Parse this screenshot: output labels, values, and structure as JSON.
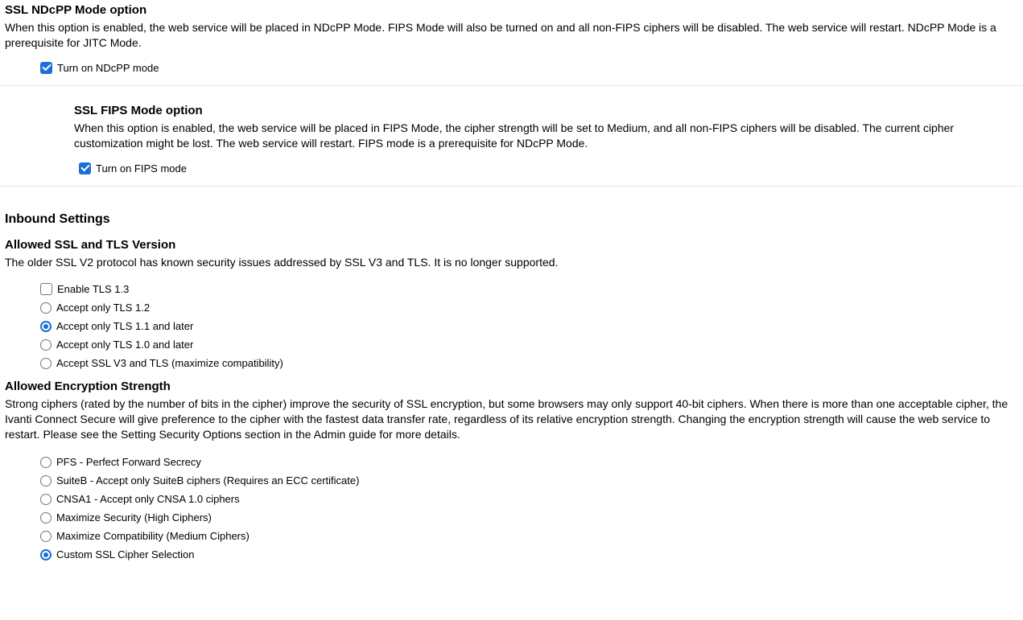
{
  "ndcpp": {
    "title": "SSL NDcPP Mode option",
    "description": "When this option is enabled, the web service will be placed in NDcPP Mode. FIPS Mode will also be turned on and all non-FIPS ciphers will be disabled. The web service will restart. NDcPP Mode is a prerequisite for JITC Mode.",
    "checkbox_label": "Turn on NDcPP mode",
    "checked": true
  },
  "fips": {
    "title": "SSL FIPS Mode option",
    "description": "When this option is enabled, the web service will be placed in FIPS Mode, the cipher strength will be set to Medium, and all non-FIPS ciphers will be disabled. The current cipher customization might be lost. The web service will restart. FIPS mode is a prerequisite for NDcPP Mode.",
    "checkbox_label": "Turn on FIPS mode",
    "checked": true
  },
  "inbound": {
    "title": "Inbound Settings"
  },
  "tls": {
    "title": "Allowed SSL and TLS Version",
    "description": "The older SSL V2 protocol has known security issues addressed by SSL V3 and TLS. It is no longer supported.",
    "options": [
      {
        "label": "Enable TLS 1.3",
        "type": "checkbox",
        "checked": false
      },
      {
        "label": "Accept only TLS 1.2",
        "type": "radio",
        "selected": false
      },
      {
        "label": "Accept only TLS 1.1 and later",
        "type": "radio",
        "selected": true
      },
      {
        "label": "Accept only TLS 1.0 and later",
        "type": "radio",
        "selected": false
      },
      {
        "label": "Accept SSL V3 and TLS (maximize compatibility)",
        "type": "radio",
        "selected": false
      }
    ]
  },
  "encryption": {
    "title": "Allowed Encryption Strength",
    "description": "Strong ciphers (rated by the number of bits in the cipher) improve the security of SSL encryption, but some browsers may only support 40-bit ciphers. When there is more than one acceptable cipher, the Ivanti Connect Secure will give preference to the cipher with the fastest data transfer rate, regardless of its relative encryption strength. Changing the encryption strength will cause the web service to restart. Please see the Setting Security Options section in the Admin guide for more details.",
    "options": [
      {
        "label": "PFS - Perfect Forward Secrecy",
        "selected": false
      },
      {
        "label": "SuiteB - Accept only SuiteB ciphers (Requires an ECC certificate)",
        "selected": false
      },
      {
        "label": "CNSA1 - Accept only CNSA 1.0 ciphers",
        "selected": false
      },
      {
        "label": "Maximize Security (High Ciphers)",
        "selected": false
      },
      {
        "label": "Maximize Compatibility (Medium Ciphers)",
        "selected": false
      },
      {
        "label": "Custom SSL Cipher Selection",
        "selected": true
      }
    ]
  }
}
